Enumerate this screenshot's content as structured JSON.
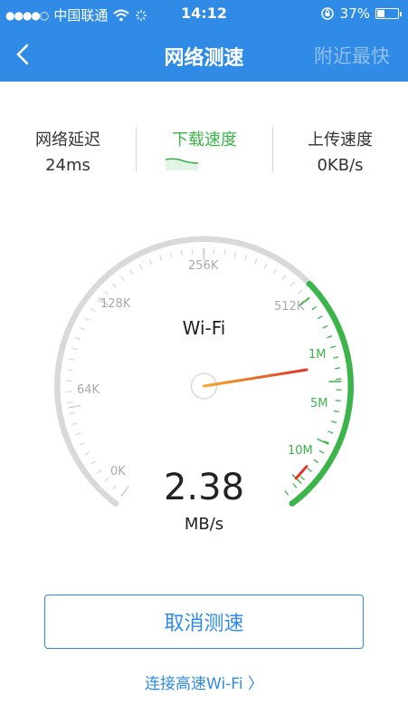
{
  "status_bar": {
    "signal": "●●●●○",
    "carrier": "中国联通",
    "time": "14:12",
    "battery_text": "37%",
    "battery_level": 0.37
  },
  "nav": {
    "title": "网络测速",
    "right_action": "附近最快"
  },
  "metrics": {
    "latency": {
      "label": "网络延迟",
      "value": "24ms"
    },
    "download": {
      "label": "下载速度",
      "value": ""
    },
    "upload": {
      "label": "上传速度",
      "value": "0KB/s"
    }
  },
  "gauge": {
    "connection": "Wi-Fi",
    "speed_value": "2.38",
    "speed_unit": "MB/s",
    "scale_labels": [
      "0K",
      "64K",
      "128K",
      "256K",
      "512K",
      "1M",
      "5M",
      "10M"
    ],
    "accent_green": "#3bb44a",
    "needle_color": "#e0352b"
  },
  "actions": {
    "cancel": "取消测速",
    "wifi_link": "连接高速Wi-Fi",
    "wifi_link_arrow": "〉"
  },
  "colors": {
    "header_bg": "#2f8be6",
    "link_blue": "#2f8be6"
  }
}
